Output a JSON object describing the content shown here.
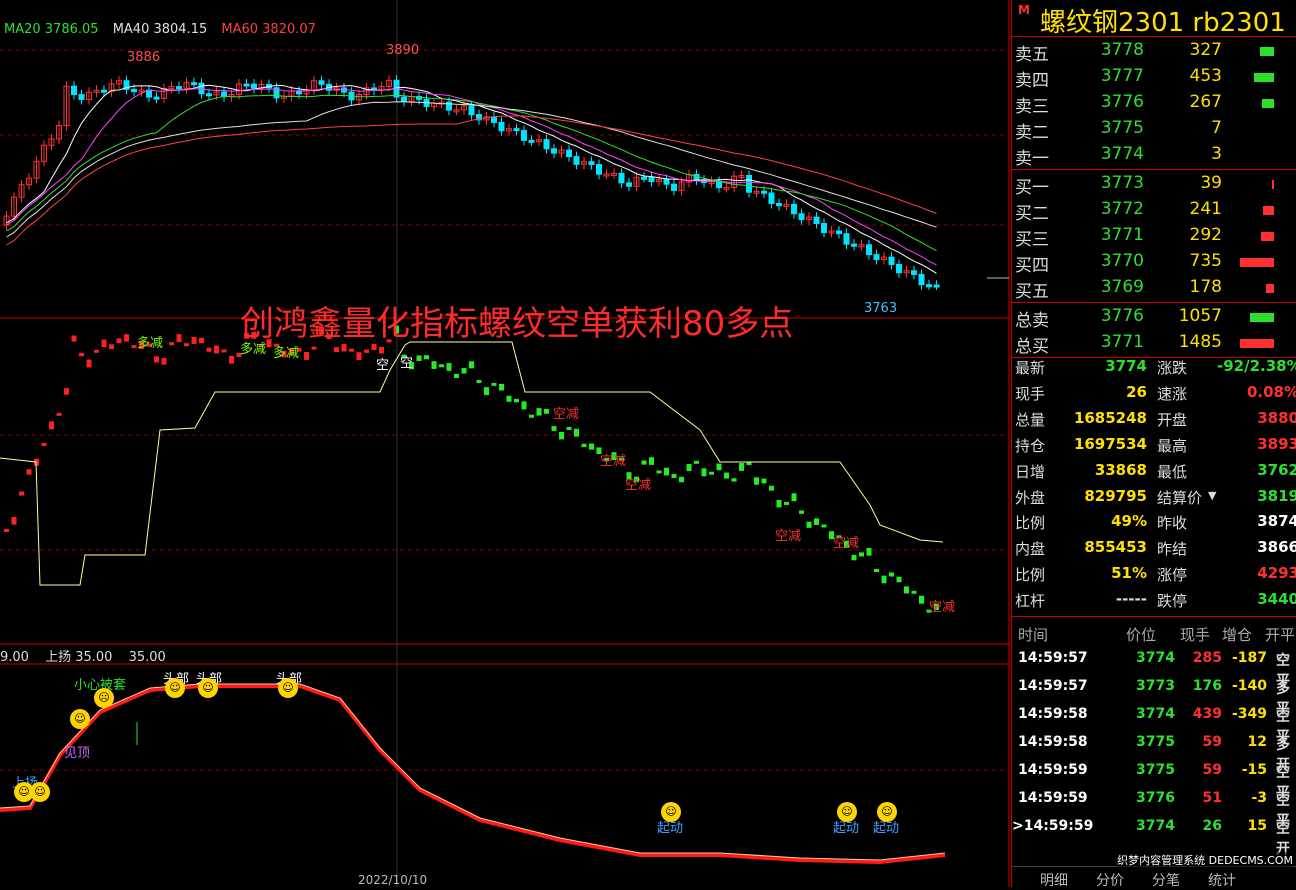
{
  "chart": {
    "ma_legend": [
      {
        "text": "MA20 3786.05",
        "color": "#2ee02e"
      },
      {
        "text": "MA40 3804.15",
        "color": "#e0e0e0"
      },
      {
        "text": "MA60 3820.07",
        "color": "#ff4040"
      }
    ],
    "high_labels": [
      "3886",
      "3890"
    ],
    "low_label": "3763",
    "overlay_title": "创鸿鑫量化指标螺纹空单获利80多点",
    "signals_long": [
      "多减",
      "多减",
      "多减"
    ],
    "signals_short": [
      "空减",
      "空减",
      "空减",
      "空减",
      "空减",
      "空减"
    ],
    "signals_flip": [
      "空",
      "空"
    ],
    "osc_legend": [
      "9.00",
      "上扬 35.00",
      "35.00"
    ],
    "osc_labels": {
      "careful": "小心被套",
      "peak": "见顶",
      "rise": "上扬",
      "tops": [
        "头部",
        "头部",
        "头部"
      ],
      "starts": [
        "起动",
        "起动",
        "起动"
      ]
    },
    "date": "2022/10/10"
  },
  "quote": {
    "badge": "M",
    "title": "螺纹钢2301  rb2301",
    "asks": [
      {
        "label": "卖五",
        "price": "3778",
        "vol": "327",
        "bar": 14
      },
      {
        "label": "卖四",
        "price": "3777",
        "vol": "453",
        "bar": 20
      },
      {
        "label": "卖三",
        "price": "3776",
        "vol": "267",
        "bar": 12
      },
      {
        "label": "卖二",
        "price": "3775",
        "vol": "7",
        "bar": 0
      },
      {
        "label": "卖一",
        "price": "3774",
        "vol": "3",
        "bar": 0
      }
    ],
    "bids": [
      {
        "label": "买一",
        "price": "3773",
        "vol": "39",
        "bar": 2
      },
      {
        "label": "买二",
        "price": "3772",
        "vol": "241",
        "bar": 11
      },
      {
        "label": "买三",
        "price": "3771",
        "vol": "292",
        "bar": 13
      },
      {
        "label": "买四",
        "price": "3770",
        "vol": "735",
        "bar": 34
      },
      {
        "label": "买五",
        "price": "3769",
        "vol": "178",
        "bar": 8
      }
    ],
    "totals": [
      {
        "label": "总卖",
        "price": "3776",
        "vol": "1057",
        "bar": 24,
        "color": "#2ee02e"
      },
      {
        "label": "总买",
        "price": "3771",
        "vol": "1485",
        "bar": 34,
        "color": "#ff3030"
      }
    ],
    "stats_left": [
      {
        "k": "最新",
        "v": "3774",
        "c": "#2ee02e"
      },
      {
        "k": "现手",
        "v": "26",
        "c": "#ffe000"
      },
      {
        "k": "总量",
        "v": "1685248",
        "c": "#ffe000"
      },
      {
        "k": "持仓",
        "v": "1697534",
        "c": "#ffe000"
      },
      {
        "k": "日增",
        "v": "33868",
        "c": "#ffe000"
      },
      {
        "k": "外盘",
        "v": "829795",
        "c": "#ffe000"
      },
      {
        "k": "比例",
        "v": "49%",
        "c": "#ffe000"
      },
      {
        "k": "内盘",
        "v": "855453",
        "c": "#ffe000"
      },
      {
        "k": "比例",
        "v": "51%",
        "c": "#ffe000"
      },
      {
        "k": "杠杆",
        "v": "-----",
        "c": "#ddd"
      }
    ],
    "stats_right": [
      {
        "k": "涨跌",
        "v": "-92/2.38%",
        "c": "#2ee02e"
      },
      {
        "k": "速涨",
        "v": "0.08%",
        "c": "#ff3030"
      },
      {
        "k": "开盘",
        "v": "3880",
        "c": "#ff3030"
      },
      {
        "k": "最高",
        "v": "3893",
        "c": "#ff3030"
      },
      {
        "k": "最低",
        "v": "3762",
        "c": "#2ee02e"
      },
      {
        "k": "结算价",
        "v": "3819",
        "c": "#2ee02e"
      },
      {
        "k": "昨收",
        "v": "3874",
        "c": "#fff"
      },
      {
        "k": "昨结",
        "v": "3866",
        "c": "#fff"
      },
      {
        "k": "涨停",
        "v": "4293",
        "c": "#ff3030"
      },
      {
        "k": "跌停",
        "v": "3440",
        "c": "#2ee02e"
      }
    ],
    "tick_header": [
      "时间",
      "价位",
      "现手",
      "增仓",
      "开平"
    ],
    "ticks": [
      {
        "time": "14:59:57",
        "price": "3774",
        "vol": "285",
        "vc": "#ff3030",
        "chg": "-187",
        "type": "空平"
      },
      {
        "time": "14:59:57",
        "price": "3773",
        "vol": "176",
        "vc": "#2ee02e",
        "chg": "-140",
        "type": "多平"
      },
      {
        "time": "14:59:58",
        "price": "3774",
        "vol": "439",
        "vc": "#ff3030",
        "chg": "-349",
        "type": "空平"
      },
      {
        "time": "14:59:58",
        "price": "3775",
        "vol": "59",
        "vc": "#ff3030",
        "chg": "12",
        "type": "多开"
      },
      {
        "time": "14:59:59",
        "price": "3775",
        "vol": "59",
        "vc": "#ff3030",
        "chg": "-15",
        "type": "空平"
      },
      {
        "time": "14:59:59",
        "price": "3776",
        "vol": "51",
        "vc": "#ff3030",
        "chg": "-3",
        "type": "空平"
      },
      {
        "time": ">14:59:59",
        "price": "3774",
        "vol": "26",
        "vc": "#2ee02e",
        "chg": "15",
        "type": "空开"
      }
    ],
    "tabs": [
      "明细",
      "分价",
      "分笔",
      "统计"
    ],
    "site": "织梦内容管理系统 DEDECMS.COM"
  }
}
